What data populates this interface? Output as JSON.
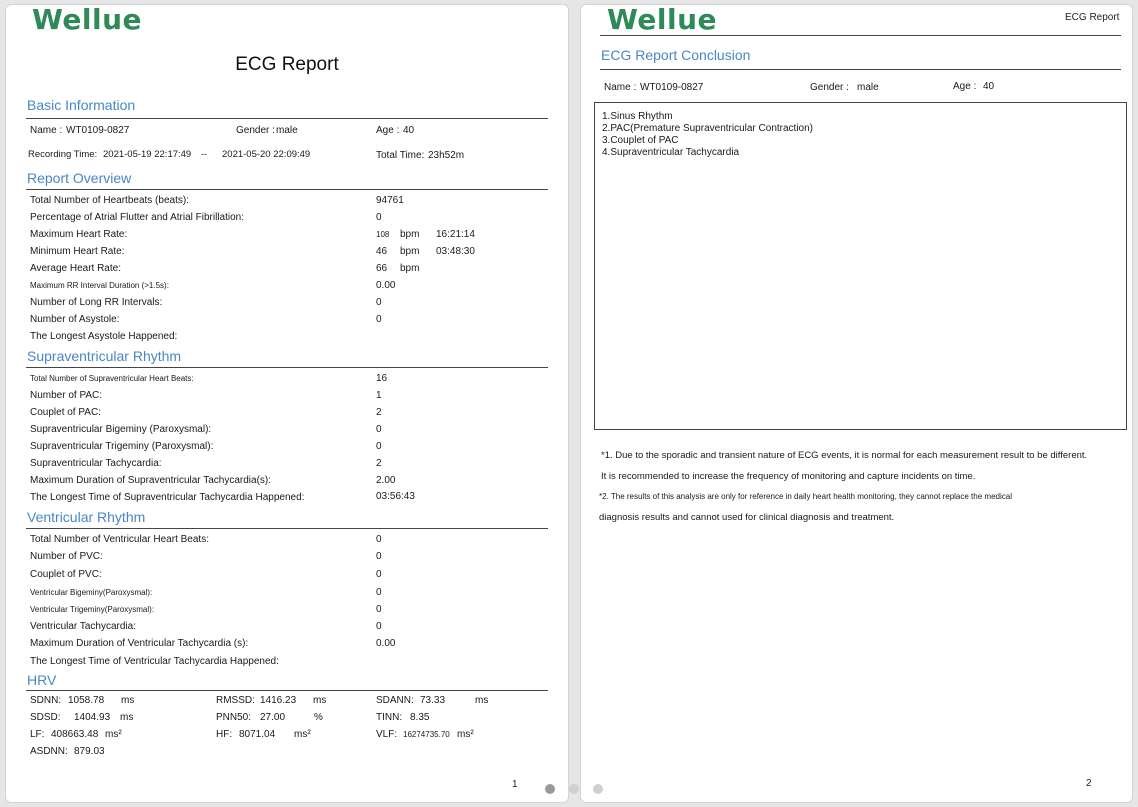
{
  "logo_text": "Wellue",
  "page1": {
    "title": "ECG Report",
    "basic": {
      "heading": "Basic Information",
      "name_label": "Name :",
      "name": "WT0109-0827",
      "gender_label": "Gender :",
      "gender": "male",
      "age_label": "Age :",
      "age": "40",
      "rec_label": "Recording Time:",
      "rec_start": "2021-05-19 22:17:49",
      "rec_sep": "--",
      "rec_end": "2021-05-20 22:09:49",
      "total_label": "Total Time:",
      "total": "23h52m"
    },
    "overview": {
      "heading": "Report Overview",
      "rows": [
        {
          "label": "Total Number of Heartbeats  (beats):",
          "value": "94761"
        },
        {
          "label": "Percentage of Atrial Flutter and Atrial Fibrillation:",
          "value": "0"
        },
        {
          "label": "Maximum Heart Rate:",
          "value": "108",
          "unit": "bpm",
          "time": "16:21:14"
        },
        {
          "label": "Minimum Heart Rate:",
          "value": "46",
          "unit": "bpm",
          "time": "03:48:30"
        },
        {
          "label": "Average Heart Rate:",
          "value": "66",
          "unit": "bpm"
        },
        {
          "label": "Maximum RR Interval Duration (>1.5s):",
          "value": "0.00"
        },
        {
          "label": "Number of Long RR Intervals:",
          "value": "0"
        },
        {
          "label": "Number of Asystole:",
          "value": "0"
        },
        {
          "label": "The Longest Asystole Happened:",
          "value": ""
        }
      ]
    },
    "supra": {
      "heading": "Supraventricular Rhythm",
      "rows": [
        {
          "label": "Total Number of Supraventricular Heart Beats:",
          "value": "16"
        },
        {
          "label": "Number of PAC:",
          "value": "1"
        },
        {
          "label": "Couplet of PAC:",
          "value": "2"
        },
        {
          "label": "Supraventricular Bigeminy (Paroxysmal):",
          "value": "0"
        },
        {
          "label": "Supraventricular Trigeminy (Paroxysmal):",
          "value": "0"
        },
        {
          "label": "Supraventricular Tachycardia:",
          "value": "2"
        },
        {
          "label": "Maximum Duration of Supraventricular Tachycardia(s):",
          "value": "2.00"
        },
        {
          "label": "The Longest Time of Supraventricular Tachycardia Happened:",
          "value": "03:56:43"
        }
      ]
    },
    "vent": {
      "heading": "Ventricular Rhythm",
      "rows": [
        {
          "label": "Total Number of Ventricular  Heart Beats:",
          "value": "0"
        },
        {
          "label": "Number of PVC:",
          "value": "0"
        },
        {
          "label": "Couplet of PVC:",
          "value": "0"
        },
        {
          "label": "Ventricular Bigeminy(Paroxysmal):",
          "value": "0"
        },
        {
          "label": "Ventricular Trigeminy(Paroxysmal):",
          "value": "0"
        },
        {
          "label": "Ventricular Tachycardia:",
          "value": "0"
        },
        {
          "label": "Maximum Duration of Ventricular Tachycardia (s):",
          "value": "0.00"
        },
        {
          "label": "The Longest Time of Ventricular Tachycardia Happened:",
          "value": ""
        }
      ]
    },
    "hrv": {
      "heading": "HRV",
      "sdnn_label": "SDNN:",
      "sdnn": "1058.78",
      "sdnn_unit": "ms",
      "rmssd_label": "RMSSD:",
      "rmssd": "1416.23",
      "rmssd_unit": "ms",
      "sdann_label": "SDANN:",
      "sdann": "73.33",
      "sdann_unit": "ms",
      "sdsd_label": "SDSD:",
      "sdsd": "1404.93",
      "sdsd_unit": "ms",
      "pnn50_label": "PNN50:",
      "pnn50": "27.00",
      "pnn50_unit": "%",
      "tinn_label": "TINN:",
      "tinn": "8.35",
      "lf_label": "LF:",
      "lf": "408663.48",
      "lf_unit": "ms²",
      "hf_label": "HF:",
      "hf": "8071.04",
      "hf_unit": "ms²",
      "vlf_label": "VLF:",
      "vlf": "16274735.70",
      "vlf_unit": "ms²",
      "asdnn_label": "ASDNN:",
      "asdnn": "879.03"
    },
    "page_number": "1"
  },
  "page2": {
    "header_right": "ECG Report",
    "heading": "ECG Report Conclusion",
    "name_label": "Name :",
    "name": "WT0109-0827",
    "gender_label": "Gender :",
    "gender": "male",
    "age_label": "Age :",
    "age": "40",
    "conclusions": [
      "1.Sinus Rhythm",
      "2.PAC(Premature Supraventricular Contraction)",
      "3.Couplet of PAC",
      "4.Supraventricular Tachycardia"
    ],
    "note1_a": "*1. Due to the sporadic and transient nature of ECG events, it is normal for each measurement result to be different.",
    "note1_b": "It is recommended to increase the frequency of monitoring and capture incidents on time.",
    "note2_a": "*2. The results of this analysis are only for reference in daily heart health monitoring, they cannot replace the medical",
    "note2_b": "diagnosis results and cannot used for clinical diagnosis and treatment.",
    "page_number": "2"
  },
  "pager": {
    "count": 3,
    "active_color": "#999999",
    "inactive_color": "#d0d0d0"
  }
}
